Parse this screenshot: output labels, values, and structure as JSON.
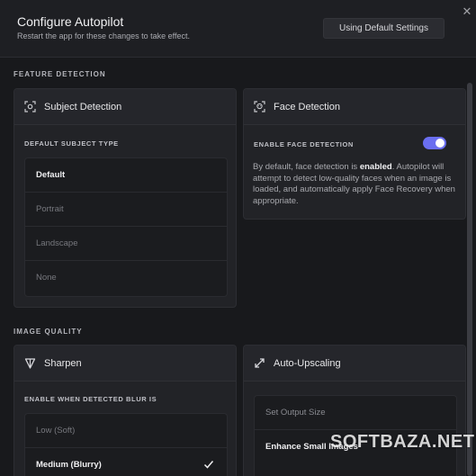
{
  "header": {
    "title": "Configure Autopilot",
    "subtitle": "Restart the app for these changes to take effect.",
    "default_button": "Using Default Settings",
    "close_glyph": "✕"
  },
  "sections": {
    "feature_detection": "FEATURE DETECTION",
    "image_quality": "IMAGE QUALITY"
  },
  "subject_detection": {
    "title": "Subject Detection",
    "icon": "subject-focus-icon",
    "sub_label": "DEFAULT SUBJECT TYPE",
    "options": [
      "Default",
      "Portrait",
      "Landscape",
      "None"
    ],
    "selected": "Default"
  },
  "face_detection": {
    "title": "Face Detection",
    "icon": "face-scan-icon",
    "toggle_label": "ENABLE FACE DETECTION",
    "enabled": true,
    "desc_before": "By default, face detection is ",
    "desc_bold": "enabled",
    "desc_after": ". Autopilot will attempt to detect low-quality faces when an image is loaded, and automatically apply Face Recovery when appropriate."
  },
  "sharpen": {
    "title": "Sharpen",
    "icon": "sharpen-triangle-icon",
    "sub_label": "ENABLE WHEN DETECTED BLUR IS",
    "options": [
      "Low (Soft)",
      "Medium (Blurry)"
    ],
    "selected": "Medium (Blurry)"
  },
  "upscaling": {
    "title": "Auto-Upscaling",
    "icon": "expand-arrows-icon",
    "options": [
      "Set Output Size",
      "Enhance Small Images"
    ],
    "selected": "Enhance Small Images"
  },
  "watermark": "SOFTBAZA.NET",
  "colors": {
    "accent": "#6a6ef0",
    "background": "#18191c",
    "card": "#222327"
  }
}
